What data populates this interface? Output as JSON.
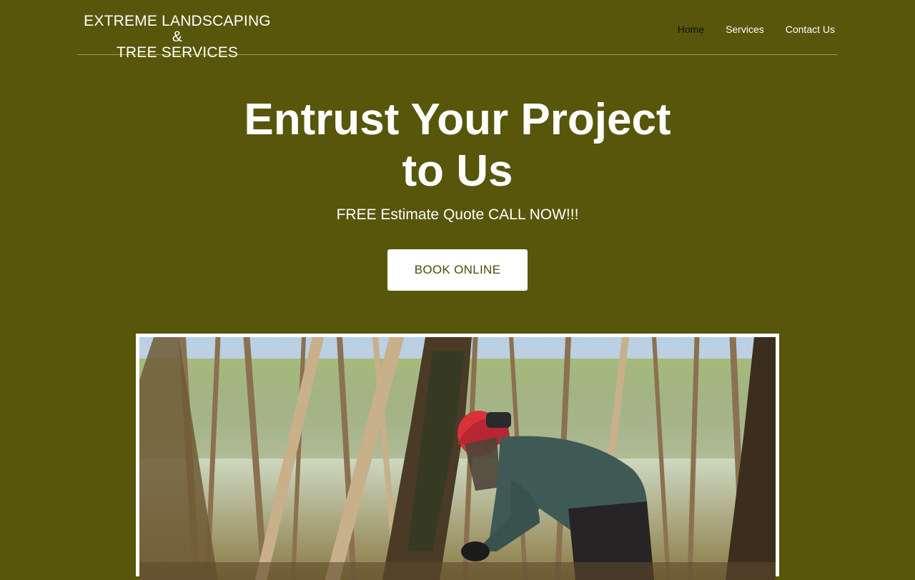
{
  "header": {
    "logo_line1": "EXTREME LANDSCAPING &",
    "logo_line2": "TREE SERVICES",
    "nav": [
      {
        "label": "Home"
      },
      {
        "label": "Services"
      },
      {
        "label": "Contact Us"
      }
    ],
    "active_nav": "Home"
  },
  "hero": {
    "title_line1": "Entrust Your Project",
    "title_line2": "to Us",
    "subtitle": "FREE Estimate Quote CALL NOW!!!",
    "cta_label": "BOOK ONLINE"
  },
  "colors": {
    "background": "#57560a",
    "button_text": "#4d4c08",
    "active_nav": "#101000"
  }
}
